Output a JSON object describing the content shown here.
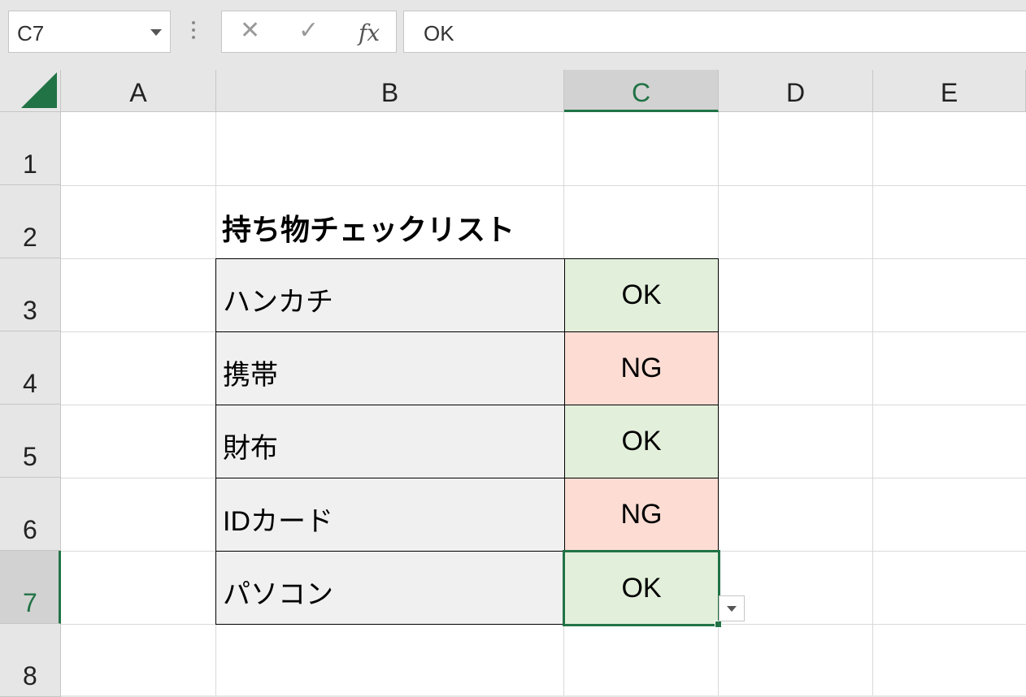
{
  "formula_bar": {
    "name_box": "C7",
    "cancel_icon": "✕",
    "enter_icon": "✓",
    "fx_icon": "fx",
    "content": "OK"
  },
  "columns": [
    "A",
    "B",
    "C",
    "D",
    "E"
  ],
  "rows": [
    "1",
    "2",
    "3",
    "4",
    "5",
    "6",
    "7",
    "8"
  ],
  "sheet": {
    "title": "持ち物チェックリスト",
    "items": [
      {
        "name": "ハンカチ",
        "status": "OK"
      },
      {
        "name": "携帯",
        "status": "NG"
      },
      {
        "name": "財布",
        "status": "OK"
      },
      {
        "name": "IDカード",
        "status": "NG"
      },
      {
        "name": "パソコン",
        "status": "OK"
      }
    ]
  },
  "colors": {
    "accent": "#217346",
    "ok_fill": "#e2efda",
    "ng_fill": "#fddcd3",
    "item_fill": "#f0f0f0"
  }
}
